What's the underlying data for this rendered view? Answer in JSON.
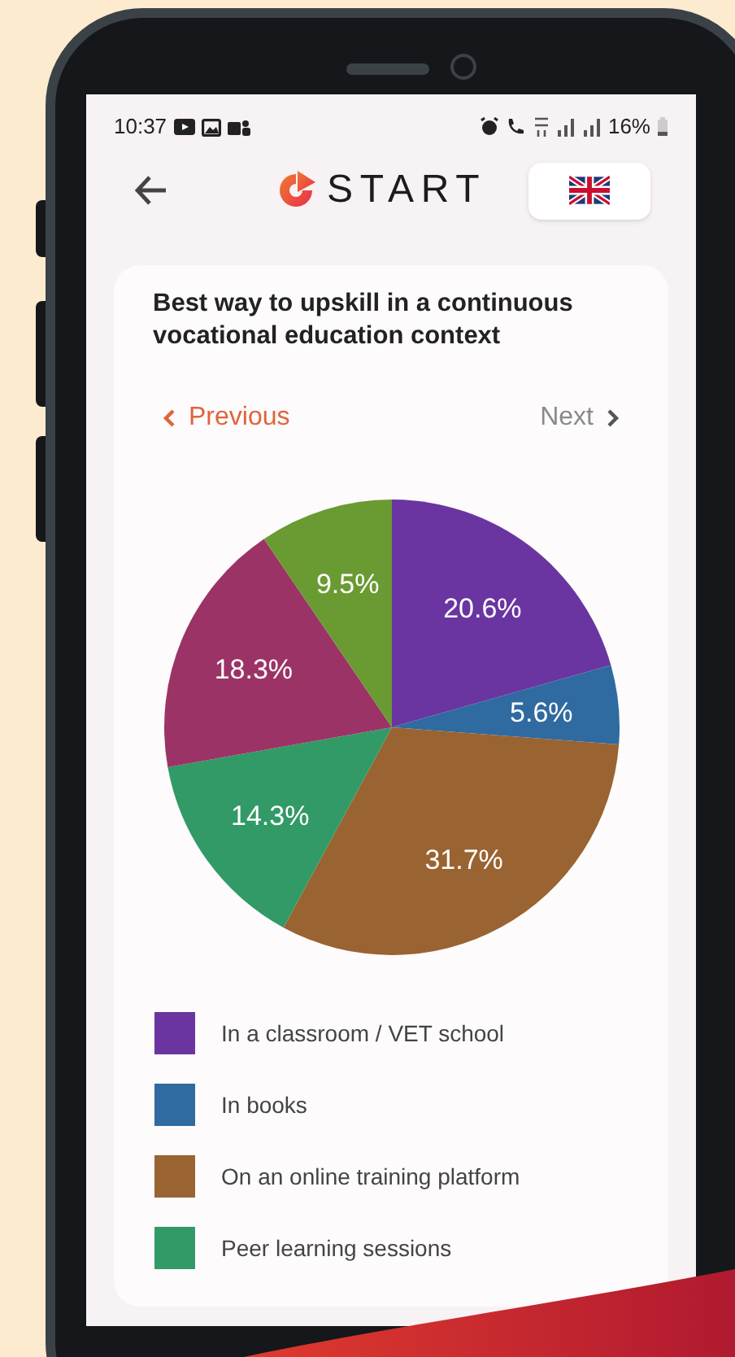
{
  "status_bar": {
    "time": "10:37",
    "battery": "16%"
  },
  "header": {
    "logo_text": "START"
  },
  "card": {
    "title": "Best way to upskill in a continuous vocational education context",
    "nav": [
      {
        "label": "Previous",
        "disabled": false
      },
      {
        "label": "Next",
        "disabled": true
      }
    ],
    "chart_data": {
      "type": "pie",
      "value_labels": [
        "20.6%",
        "5.6%",
        "31.7%",
        "14.3%",
        "18.3%",
        "9.5%"
      ],
      "series": [
        {
          "values": [
            20.6,
            5.6,
            31.7,
            14.3,
            18.3,
            9.5
          ]
        }
      ],
      "colors": [
        "#6a35a0",
        "#2f6aa0",
        "#9a6332",
        "#329a66",
        "#9c3366",
        "#6a9a32"
      ]
    },
    "legend": [
      {
        "label": "In a classroom / VET school",
        "color": "#6a35a0"
      },
      {
        "label": "In books",
        "color": "#2f6aa0"
      },
      {
        "label": "On an online training platform",
        "color": "#9a6332"
      },
      {
        "label": "Peer learning sessions",
        "color": "#329a66"
      }
    ]
  }
}
